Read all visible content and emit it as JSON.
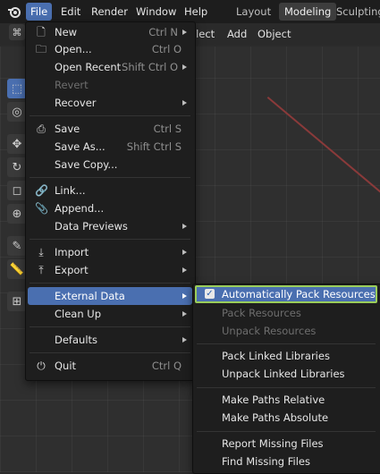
{
  "menubar": {
    "items": [
      "File",
      "Edit",
      "Render",
      "Window",
      "Help"
    ],
    "active": "File",
    "workspaces": [
      "Layout",
      "Modeling",
      "Sculpting"
    ],
    "active_workspace": "Modeling"
  },
  "viewport_header": {
    "items": [
      "elect",
      "Add",
      "Object"
    ]
  },
  "file_menu": {
    "new": {
      "label": "New",
      "shortcut": "Ctrl N"
    },
    "open": {
      "label": "Open...",
      "shortcut": "Ctrl O"
    },
    "open_recent": {
      "label": "Open Recent",
      "shortcut": "Shift Ctrl O"
    },
    "revert": {
      "label": "Revert"
    },
    "recover": {
      "label": "Recover"
    },
    "save": {
      "label": "Save",
      "shortcut": "Ctrl S"
    },
    "save_as": {
      "label": "Save As...",
      "shortcut": "Shift Ctrl S"
    },
    "save_copy": {
      "label": "Save Copy..."
    },
    "link": {
      "label": "Link..."
    },
    "append": {
      "label": "Append..."
    },
    "data_previews": {
      "label": "Data Previews"
    },
    "import": {
      "label": "Import"
    },
    "export": {
      "label": "Export"
    },
    "external_data": {
      "label": "External Data"
    },
    "clean_up": {
      "label": "Clean Up"
    },
    "defaults": {
      "label": "Defaults"
    },
    "quit": {
      "label": "Quit",
      "shortcut": "Ctrl Q"
    }
  },
  "external_data_menu": {
    "auto_pack": {
      "label": "Automatically Pack Resources",
      "checked": true
    },
    "pack_resources": "Pack Resources",
    "unpack_resources": "Unpack Resources",
    "pack_linked": "Pack Linked Libraries",
    "unpack_linked": "Unpack Linked Libraries",
    "make_relative": "Make Paths Relative",
    "make_absolute": "Make Paths Absolute",
    "report_missing": "Report Missing Files",
    "find_missing": "Find Missing Files"
  },
  "colors": {
    "highlight": "#4a6fb0",
    "callout_border": "#9acd5a",
    "menu_bg": "#1e1e1e"
  }
}
